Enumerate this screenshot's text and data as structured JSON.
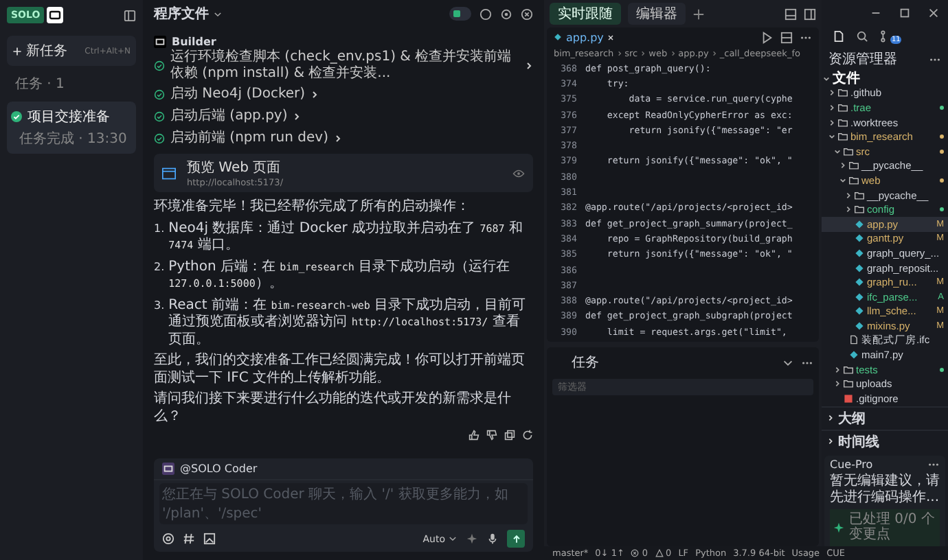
{
  "sidebar": {
    "logo": "SOLO",
    "new_task": {
      "label": "新任务",
      "shortcut": "Ctrl+Alt+N"
    },
    "section": "任务 · 1",
    "tasks": [
      {
        "title": "项目交接准备",
        "subtitle": "任务完成 · 13:30",
        "selected": true,
        "done": true
      }
    ]
  },
  "chat": {
    "title": "程序文件",
    "agent": "Builder",
    "steps": [
      {
        "text": "运行环境检查脚本 (check_env.ps1) & 检查并安装前端依赖 (npm install) & 检查并安装...",
        "done": true
      },
      {
        "text": "启动 Neo4j (Docker)",
        "done": true
      },
      {
        "text": "启动后端 (app.py)",
        "done": true
      },
      {
        "text": "启动前端 (npm run dev)",
        "done": true
      }
    ],
    "preview": {
      "title": "预览 Web 页面",
      "url": "http://localhost:5173/"
    },
    "intro": "环境准备完毕！我已经帮你完成了所有的启动操作：",
    "list": [
      {
        "num": "1.",
        "parts": [
          {
            "code": false,
            "t": "Neo4j 数据库：通过 Docker 成功拉取并启动在了 "
          },
          {
            "code": true,
            "t": "7687"
          },
          {
            "code": false,
            "t": " 和 "
          },
          {
            "code": true,
            "t": "7474"
          },
          {
            "code": false,
            "t": " 端口。"
          }
        ]
      },
      {
        "num": "2.",
        "parts": [
          {
            "code": false,
            "t": "Python 后端：在 "
          },
          {
            "code": true,
            "t": "bim_research"
          },
          {
            "code": false,
            "t": " 目录下成功启动（运行在 "
          },
          {
            "code": true,
            "t": "127.0.0.1:5000"
          },
          {
            "code": false,
            "t": "）。"
          }
        ]
      },
      {
        "num": "3.",
        "parts": [
          {
            "code": false,
            "t": "React 前端：在 "
          },
          {
            "code": true,
            "t": "bim-research-web"
          },
          {
            "code": false,
            "t": " 目录下成功启动，目前可通过预览面板或者浏览器访问 "
          },
          {
            "code": true,
            "t": "http://localhost:5173/"
          },
          {
            "code": false,
            "t": " 查看页面。"
          }
        ]
      }
    ],
    "outro": "至此，我们的交接准备工作已经圆满完成！你可以打开前端页面测试一下 IFC 文件的上传解析功能。",
    "question": "请问我们接下来要进行什么功能的迭代或开发的新需求是什么？",
    "composer": {
      "mention": "@SOLO Coder",
      "placeholder": "您正在与 SOLO Coder 聊天，输入 '/' 获取更多能力，如 '/plan'、'/spec'",
      "mode": "Auto"
    }
  },
  "editor": {
    "tabs": [
      {
        "label": "实时跟随",
        "selected": true
      },
      {
        "label": "编辑器",
        "selected": false
      }
    ],
    "file_tab": "app.py",
    "breadcrumb": [
      "bim_research",
      "src",
      "web",
      "app.py",
      "_call_deepseek_fo"
    ],
    "lines": [
      {
        "n": "368",
        "code": "def post_graph_query():"
      },
      {
        "n": "374",
        "code": "    try:"
      },
      {
        "n": "375",
        "code": "        data = service.run_query(cyphe"
      },
      {
        "n": "376",
        "code": "    except ReadOnlyCypherError as exc:"
      },
      {
        "n": "377",
        "code": "        return jsonify({\"message\": \"er"
      },
      {
        "n": "378"
      },
      {
        "n": "379",
        "code": "    return jsonify({\"message\": \"ok\", \""
      },
      {
        "n": "380"
      },
      {
        "n": "381"
      },
      {
        "n": "382",
        "code": "@app.route(\"/api/projects/<project_id>"
      },
      {
        "n": "383",
        "code": "def get_project_graph_summary(project_"
      },
      {
        "n": "384",
        "code": "    repo = GraphRepository(build_graph"
      },
      {
        "n": "385",
        "code": "    return jsonify({\"message\": \"ok\", \""
      },
      {
        "n": "386"
      },
      {
        "n": "387"
      },
      {
        "n": "388",
        "code": "@app.route(\"/api/projects/<project_id>"
      },
      {
        "n": "389",
        "code": "def get_project_graph_subgraph(project"
      },
      {
        "n": "390",
        "code": "    limit = request.args.get(\"limit\","
      }
    ]
  },
  "task_panel": {
    "title": "任务",
    "filter_placeholder": "筛选器"
  },
  "explorer": {
    "title": "资源管理器",
    "badge": "11",
    "tree": [
      {
        "name": "文件",
        "kind": "root",
        "expanded": true,
        "children": [
          {
            "name": ".github",
            "kind": "folder",
            "expanded": false
          },
          {
            "name": ".trae",
            "kind": "folder",
            "expanded": false,
            "color": "#4ec98a",
            "dot": true
          },
          {
            "name": ".worktrees",
            "kind": "folder",
            "expanded": false
          },
          {
            "name": "bim_research",
            "kind": "folder",
            "expanded": true,
            "color": "#d8b36a",
            "dot": true,
            "children": [
              {
                "name": "src",
                "kind": "folder",
                "expanded": true,
                "color": "#d8b36a",
                "dot": true,
                "children": [
                  {
                    "name": "__pycache__",
                    "kind": "folder",
                    "expanded": false
                  },
                  {
                    "name": "web",
                    "kind": "folder",
                    "expanded": true,
                    "color": "#d8b36a",
                    "dot": true,
                    "children": [
                      {
                        "name": "__pycache__",
                        "kind": "folder",
                        "expanded": false
                      },
                      {
                        "name": "config",
                        "kind": "folder",
                        "expanded": false,
                        "color": "#4ec98a",
                        "dot": true
                      },
                      {
                        "name": "app.py",
                        "kind": "py",
                        "selected": true,
                        "color": "#d8b36a",
                        "badge": "M"
                      },
                      {
                        "name": "gantt.py",
                        "kind": "py",
                        "selected": false,
                        "color": "#d8b36a",
                        "badge": "M"
                      },
                      {
                        "name": "graph_query_...",
                        "kind": "py",
                        "selected": false
                      },
                      {
                        "name": "graph_reposit...",
                        "kind": "py",
                        "selected": false
                      },
                      {
                        "name": "graph_ru...",
                        "kind": "py",
                        "selected": false,
                        "color": "#d8b36a",
                        "badge": "M"
                      },
                      {
                        "name": "ifc_parse...",
                        "kind": "py",
                        "selected": false,
                        "color": "#4ec98a",
                        "badge": "A"
                      },
                      {
                        "name": "llm_sche...",
                        "kind": "py",
                        "selected": false,
                        "color": "#d8b36a",
                        "badge": "M"
                      },
                      {
                        "name": "mixins.py",
                        "kind": "py",
                        "selected": false,
                        "color": "#d8b36a",
                        "badge": "M"
                      }
                    ]
                  },
                  {
                    "name": "装配式厂房.ifc",
                    "kind": "doc",
                    "selected": false
                  },
                  {
                    "name": "main7.py",
                    "kind": "py",
                    "selected": false
                  }
                ]
              },
              {
                "name": "tests",
                "kind": "folder",
                "expanded": false,
                "color": "#4ec98a",
                "dot": true
              },
              {
                "name": "uploads",
                "kind": "folder",
                "expanded": false
              },
              {
                "name": ".gitignore",
                "kind": "git",
                "selected": false
              }
            ]
          }
        ]
      }
    ],
    "sections": [
      {
        "title": "大纲",
        "expanded": false
      },
      {
        "title": "时间线",
        "expanded": false
      }
    ],
    "cue": {
      "title": "Cue-Pro",
      "message": "暂无编辑建议，请先进行编码操作...",
      "status": "已处理 0/0 个变更点"
    }
  },
  "status_bar": {
    "branch": "master*",
    "sync": "0↓ 1↑",
    "errors": "0",
    "warnings": "0",
    "eol": "LF",
    "lang": "Python",
    "version": "3.7.9 64-bit",
    "usage": "Usage",
    "cue": "CUE"
  }
}
